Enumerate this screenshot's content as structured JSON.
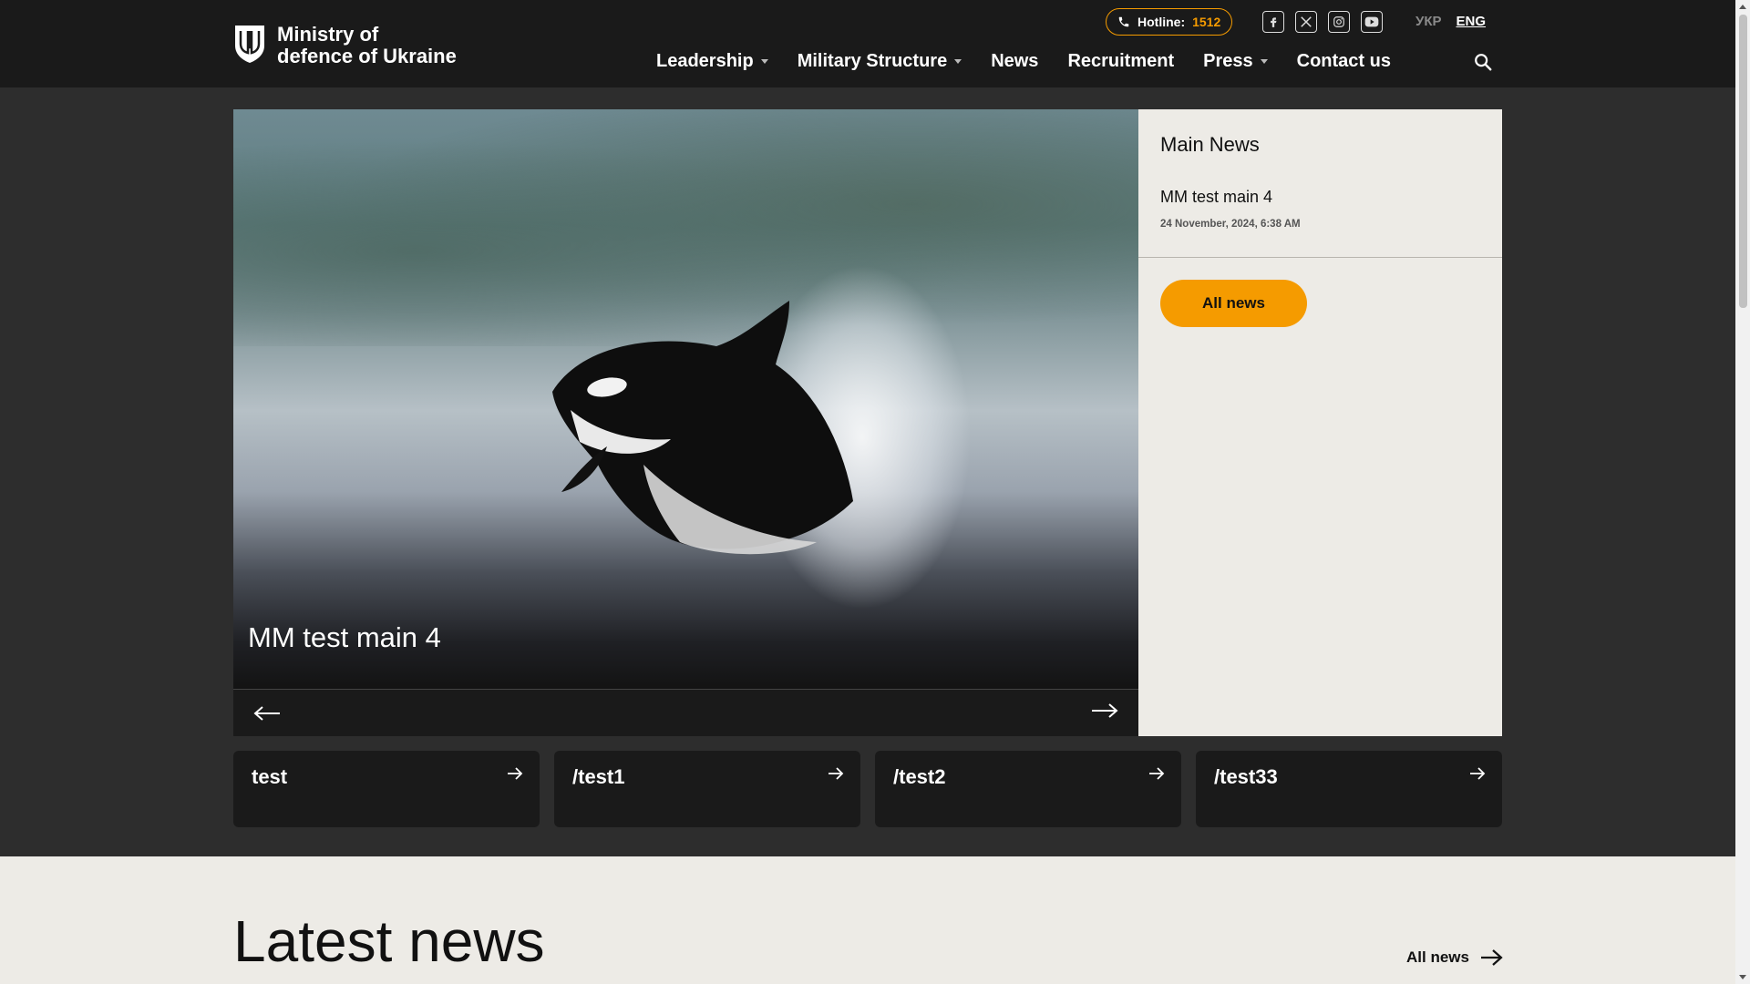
{
  "header": {
    "logo_line1": "Ministry of",
    "logo_line2": "defence of Ukraine",
    "hotline_label": "Hotline:",
    "hotline_number": "1512",
    "socials": [
      "facebook-icon",
      "x-twitter-icon",
      "instagram-icon",
      "youtube-icon"
    ],
    "lang_ukr": "УКР",
    "lang_eng": "ENG",
    "nav": [
      {
        "label": "Leadership",
        "dropdown": true
      },
      {
        "label": "Military Structure",
        "dropdown": true
      },
      {
        "label": "News",
        "dropdown": false
      },
      {
        "label": "Recruitment",
        "dropdown": false
      },
      {
        "label": "Press",
        "dropdown": true
      },
      {
        "label": "Contact us",
        "dropdown": false
      }
    ]
  },
  "hero": {
    "title": "MM test main 4"
  },
  "main_news": {
    "title": "Main News",
    "items": [
      {
        "title": "MM test main 4",
        "date": "24 November, 2024, 6:38 AM"
      }
    ],
    "all_news_label": "All news"
  },
  "tiles": [
    {
      "label": "test"
    },
    {
      "label": "/test1"
    },
    {
      "label": "/test2"
    },
    {
      "label": "/test33"
    }
  ],
  "latest": {
    "title": "Latest news",
    "all_news_label": "All news"
  },
  "colors": {
    "accent": "#f59b00",
    "header_bg": "#1a1a1a",
    "page_bg": "#2d2d2d",
    "panel_bg": "#edebe6"
  }
}
